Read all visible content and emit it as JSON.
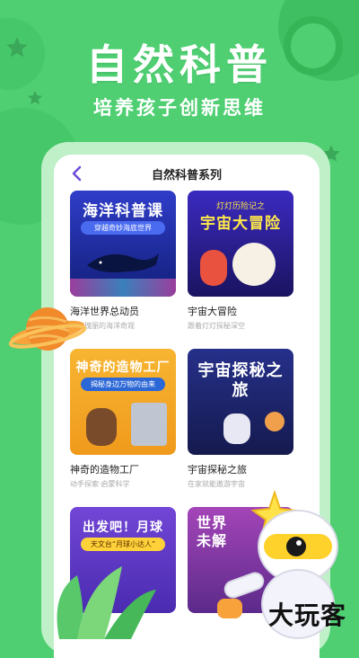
{
  "hero": {
    "title": "自然科普",
    "subtitle": "培养孩子创新思维"
  },
  "screen": {
    "nav_title": "自然科普系列"
  },
  "cards": [
    {
      "cover_title": "海洋科普课",
      "cover_pill": "穿越奇妙海底世界",
      "title": "海洋世界总动员",
      "desc": "神秘瑰丽的海洋奇观"
    },
    {
      "cover_title": "宇宙大冒险",
      "cover_pill": "灯灯历险记之",
      "title": "宇宙大冒险",
      "desc": "跟着灯灯探秘深空"
    },
    {
      "cover_title": "神奇的造物工厂",
      "cover_pill": "揭秘身边万物的由来",
      "title": "神奇的造物工厂",
      "desc": "动手探索·启蒙科学"
    },
    {
      "cover_title": "宇宙探秘之旅",
      "cover_pill": "",
      "title": "宇宙探秘之旅",
      "desc": "在家就能遨游宇宙"
    },
    {
      "cover_title": "出发吧！月球",
      "cover_pill": "天文台“月球小达人”",
      "title": "",
      "desc": ""
    },
    {
      "cover_title": "世界未解",
      "cover_pill": "",
      "title": "",
      "desc": ""
    }
  ],
  "watermark": "大玩客",
  "colors": {
    "background": "#4fcf72",
    "phone_frame": "#bff0c7",
    "accent_purple": "#6b4bd8"
  },
  "icons": {
    "back": "chevron-left-icon"
  }
}
